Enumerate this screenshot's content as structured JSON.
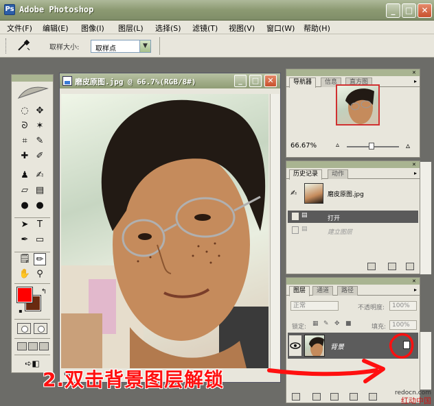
{
  "app": {
    "title": "Adobe Photoshop",
    "logo_glyph": "Ps"
  },
  "window_controls": {
    "minimize": "_",
    "maximize": "□",
    "close": "✕"
  },
  "menu": [
    "文件(F)",
    "编辑(E)",
    "图像(I)",
    "图层(L)",
    "选择(S)",
    "滤镜(T)",
    "视图(V)",
    "窗口(W)",
    "帮助(H)"
  ],
  "options_bar": {
    "tool_icon": "eyedropper-icon",
    "sample_size_label": "取样大小:",
    "sample_size_value": "取样点",
    "dropdown_arrow": "▼"
  },
  "toolbox": {
    "tools": [
      {
        "name": "marquee-tool-icon",
        "glyph": "◌"
      },
      {
        "name": "move-tool-icon",
        "glyph": "✥"
      },
      {
        "name": "lasso-tool-icon",
        "glyph": "ᘐ"
      },
      {
        "name": "magic-wand-tool-icon",
        "glyph": "✶"
      },
      {
        "name": "crop-tool-icon",
        "glyph": "⌗"
      },
      {
        "name": "slice-tool-icon",
        "glyph": "✎"
      },
      {
        "name": "healing-brush-tool-icon",
        "glyph": "✚"
      },
      {
        "name": "brush-tool-icon",
        "glyph": "✐"
      },
      {
        "name": "clone-stamp-tool-icon",
        "glyph": "♟"
      },
      {
        "name": "history-brush-tool-icon",
        "glyph": "✍"
      },
      {
        "name": "eraser-tool-icon",
        "glyph": "▱"
      },
      {
        "name": "gradient-tool-icon",
        "glyph": "▤"
      },
      {
        "name": "blur-tool-icon",
        "glyph": "●"
      },
      {
        "name": "dodge-tool-icon",
        "glyph": "●"
      },
      {
        "name": "path-selection-tool-icon",
        "glyph": "➤"
      },
      {
        "name": "type-tool-icon",
        "glyph": "T"
      },
      {
        "name": "pen-tool-icon",
        "glyph": "✒"
      },
      {
        "name": "shape-tool-icon",
        "glyph": "▭"
      },
      {
        "name": "notes-tool-icon",
        "glyph": "🗒"
      },
      {
        "name": "eyedropper-tool-icon",
        "glyph": "✏"
      },
      {
        "name": "hand-tool-icon",
        "glyph": "✋"
      },
      {
        "name": "zoom-tool-icon",
        "glyph": "⚲"
      }
    ],
    "colors": {
      "foreground": "#ff0000",
      "background": "#6a2a10"
    }
  },
  "document": {
    "title": "磨皮原图.jpg @ 66.7%(RGB/8#)",
    "status": "66."
  },
  "navigator": {
    "tabs": [
      "导航器",
      "信息",
      "直方图"
    ],
    "zoom": "66.67%"
  },
  "history": {
    "tabs": [
      "历史记录",
      "动作"
    ],
    "snapshot": "磨皮原图.jpg",
    "items": [
      {
        "label": "打开",
        "selected": true
      },
      {
        "label": "建立图层",
        "selected": false
      }
    ]
  },
  "layers": {
    "tabs": [
      "图层",
      "通道",
      "路径"
    ],
    "blend_mode": "正常",
    "opacity_label": "不透明度:",
    "opacity_value": "100%",
    "lock_label": "锁定:",
    "fill_label": "填充:",
    "fill_value": "100%",
    "layer_name": "背景"
  },
  "annotation": {
    "text": "2.双击背景图层解锁",
    "color": "#ff1010"
  },
  "watermark": {
    "url": "redocn.com",
    "name": "红动中国"
  }
}
